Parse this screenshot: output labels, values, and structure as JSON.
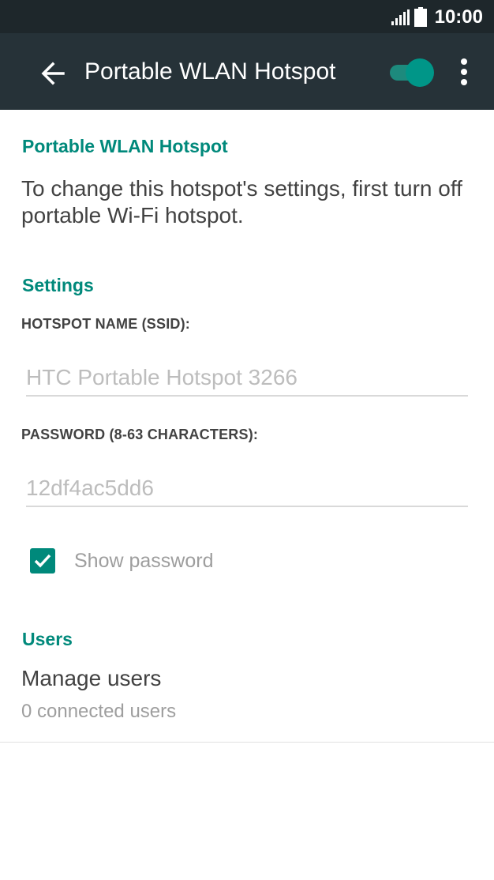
{
  "status_bar": {
    "time": "10:00",
    "signal_icon": "cellular-signal-icon",
    "battery_icon": "battery-full-icon"
  },
  "app_bar": {
    "title": "Portable WLAN Hotspot",
    "back_icon": "arrow-back-icon",
    "toggle_state": "on",
    "menu_icon": "more-vert-icon",
    "background_color": "#263238",
    "accent_color": "#009688"
  },
  "hotspot_section": {
    "header": "Portable WLAN Hotspot",
    "description": "To change this hotspot's settings, first turn off portable Wi-Fi hotspot."
  },
  "settings_section": {
    "header": "Settings",
    "ssid_label": "HOTSPOT NAME (SSID):",
    "ssid_value": "HTC Portable Hotspot 3266",
    "password_label": "PASSWORD (8-63 CHARACTERS):",
    "password_value": "12df4ac5dd6",
    "show_password_label": "Show password",
    "show_password_checked": true
  },
  "users_section": {
    "header": "Users",
    "manage_users_title": "Manage users",
    "manage_users_summary": "0 connected users"
  }
}
